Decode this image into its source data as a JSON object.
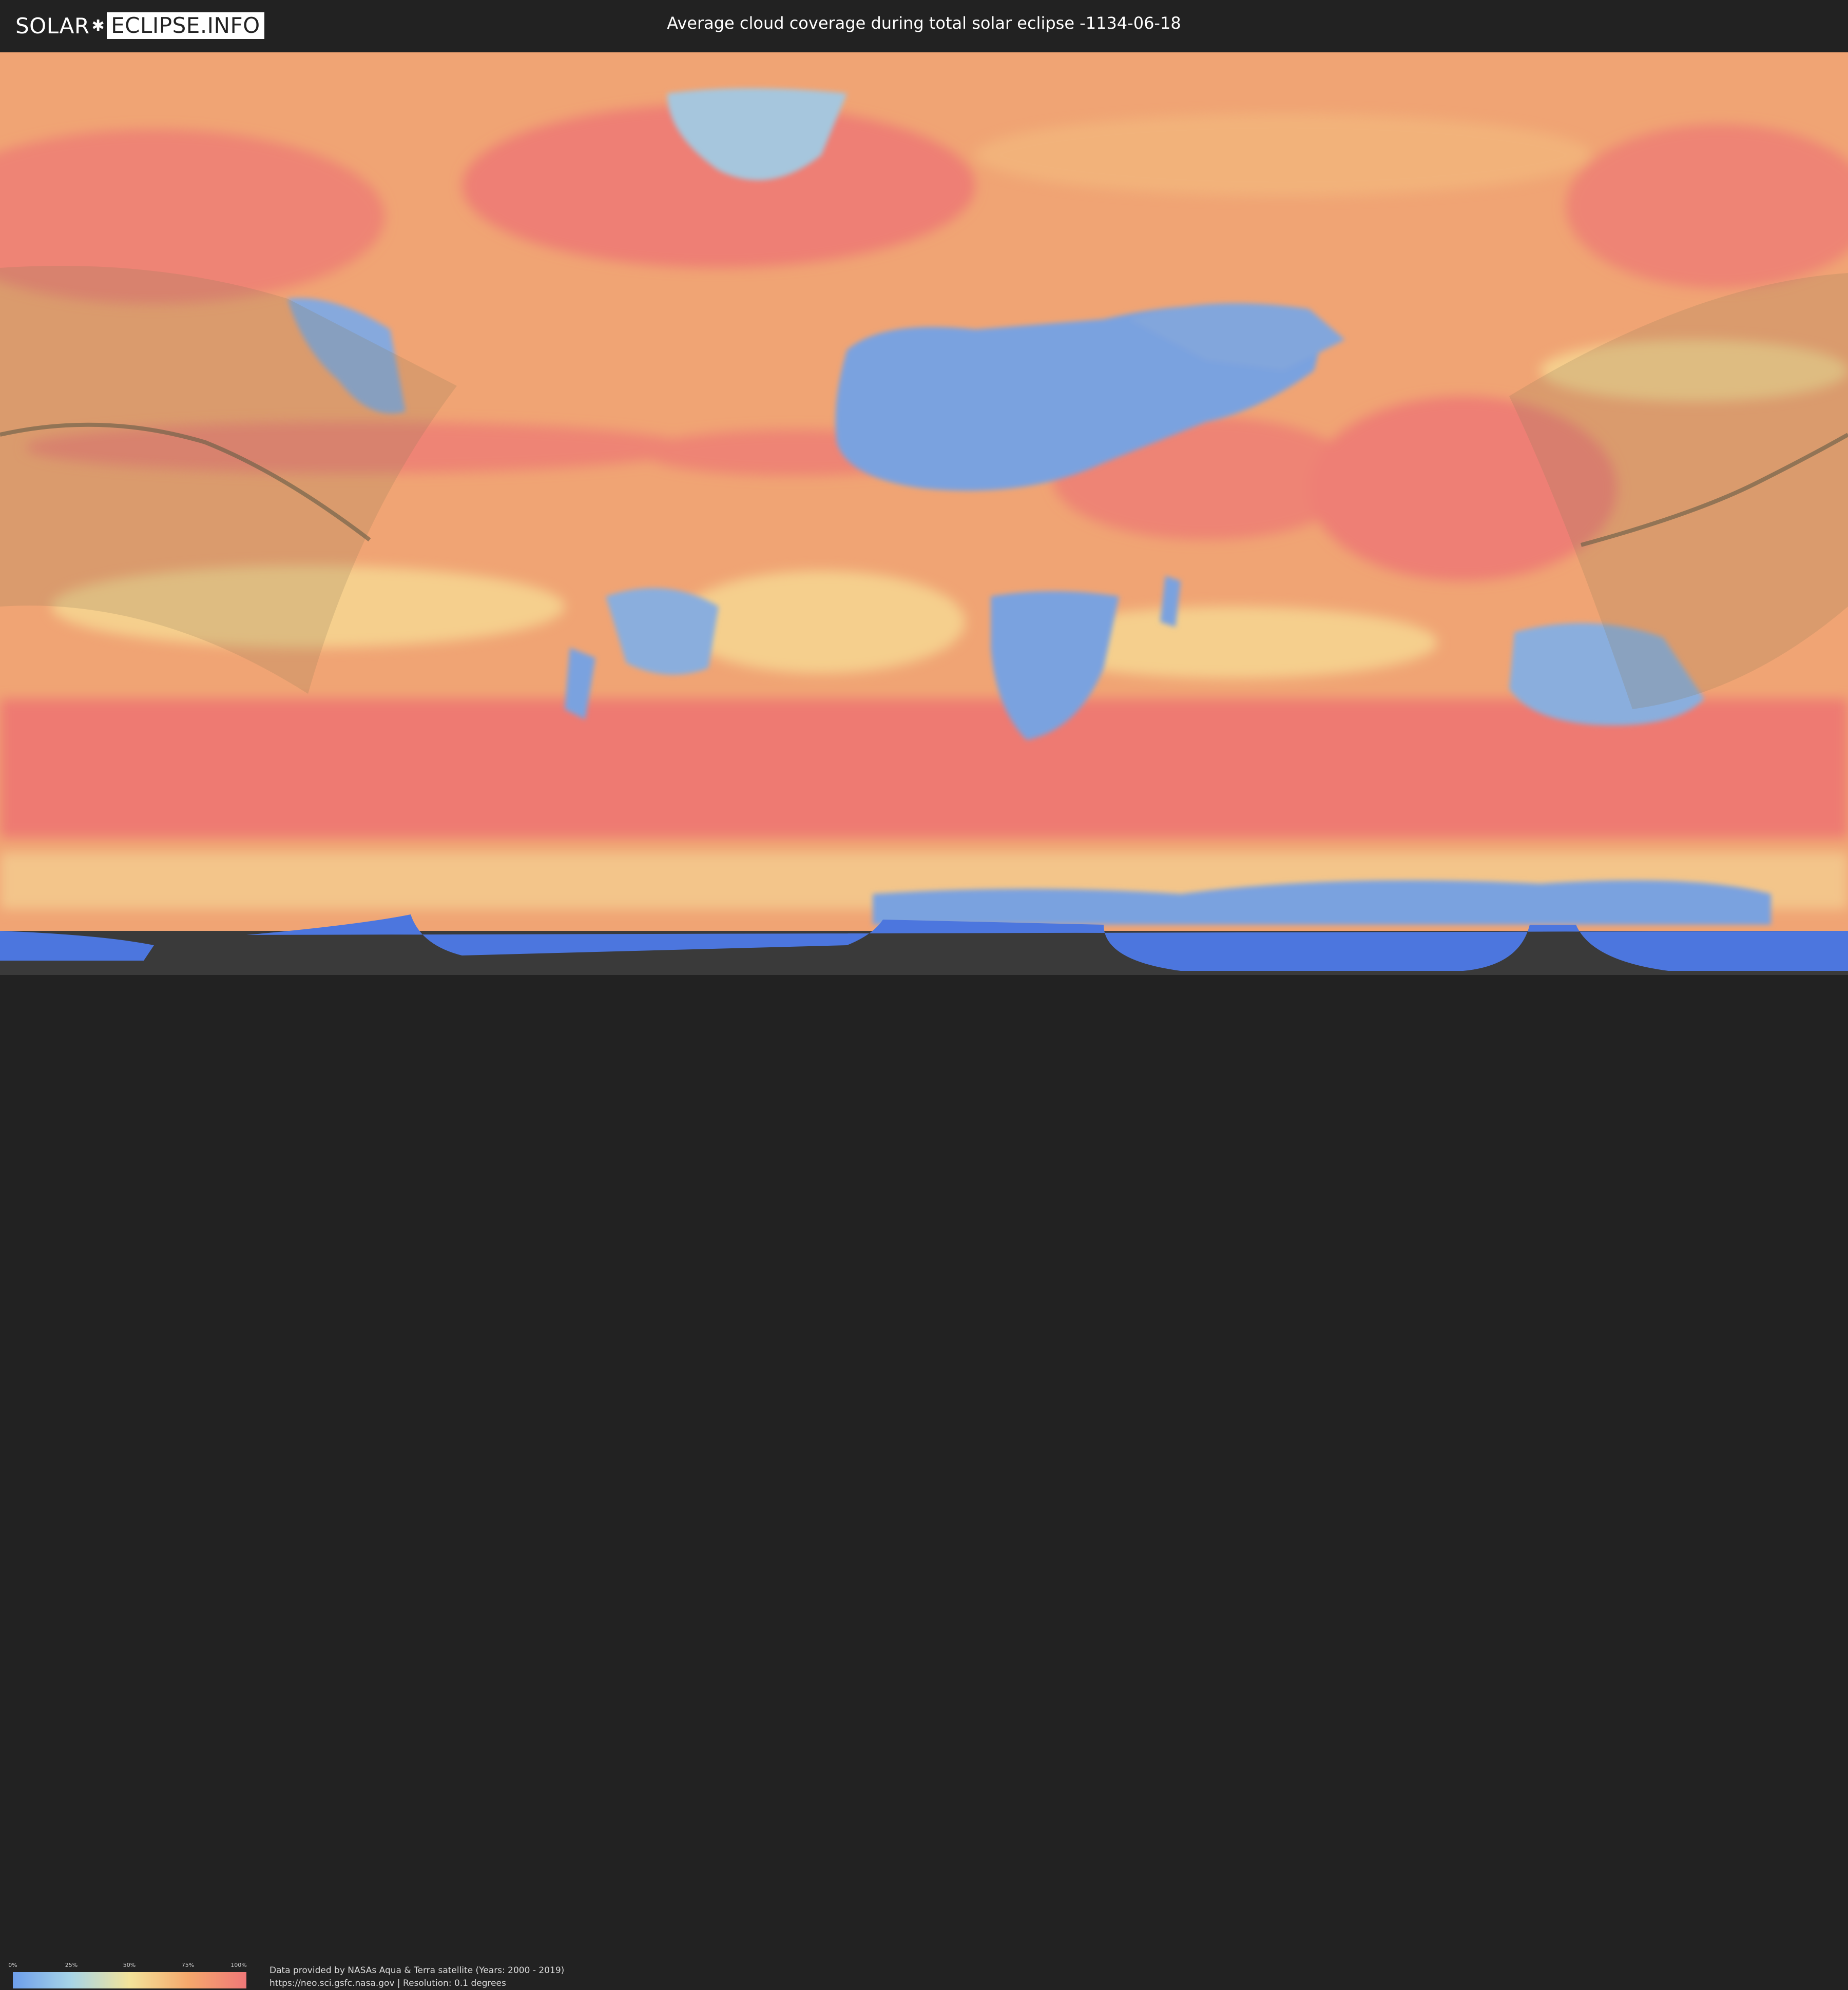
{
  "header": {
    "logo_part1": "SOLAR",
    "logo_separator": "✱",
    "logo_part2": "ECLIPSE.INFO",
    "title": "Average cloud coverage during total solar eclipse -1134-06-18"
  },
  "legend": {
    "ticks": [
      "0%",
      "25%",
      "50%",
      "75%",
      "100%"
    ],
    "colors": [
      "#6d9eeb",
      "#a7d4e6",
      "#f3e39a",
      "#f5a86c",
      "#f07878"
    ]
  },
  "credit": {
    "line1": "Data provided by NASAs Aqua & Terra satellite (Years: 2000 - 2019)",
    "line2": "https://neo.sci.gsfc.nasa.gov | Resolution: 0.1 degrees"
  },
  "map": {
    "layer": "cloud-coverage",
    "projection": "equirectangular",
    "colors": {
      "ocean_cloudy": "#ee8f72",
      "clear_land": "#79a2df",
      "medium": "#f3c98a",
      "antarctica_clear": "#4c76de",
      "no_data": "#3a3a3a",
      "eclipse_path": "#8b7a55"
    }
  }
}
